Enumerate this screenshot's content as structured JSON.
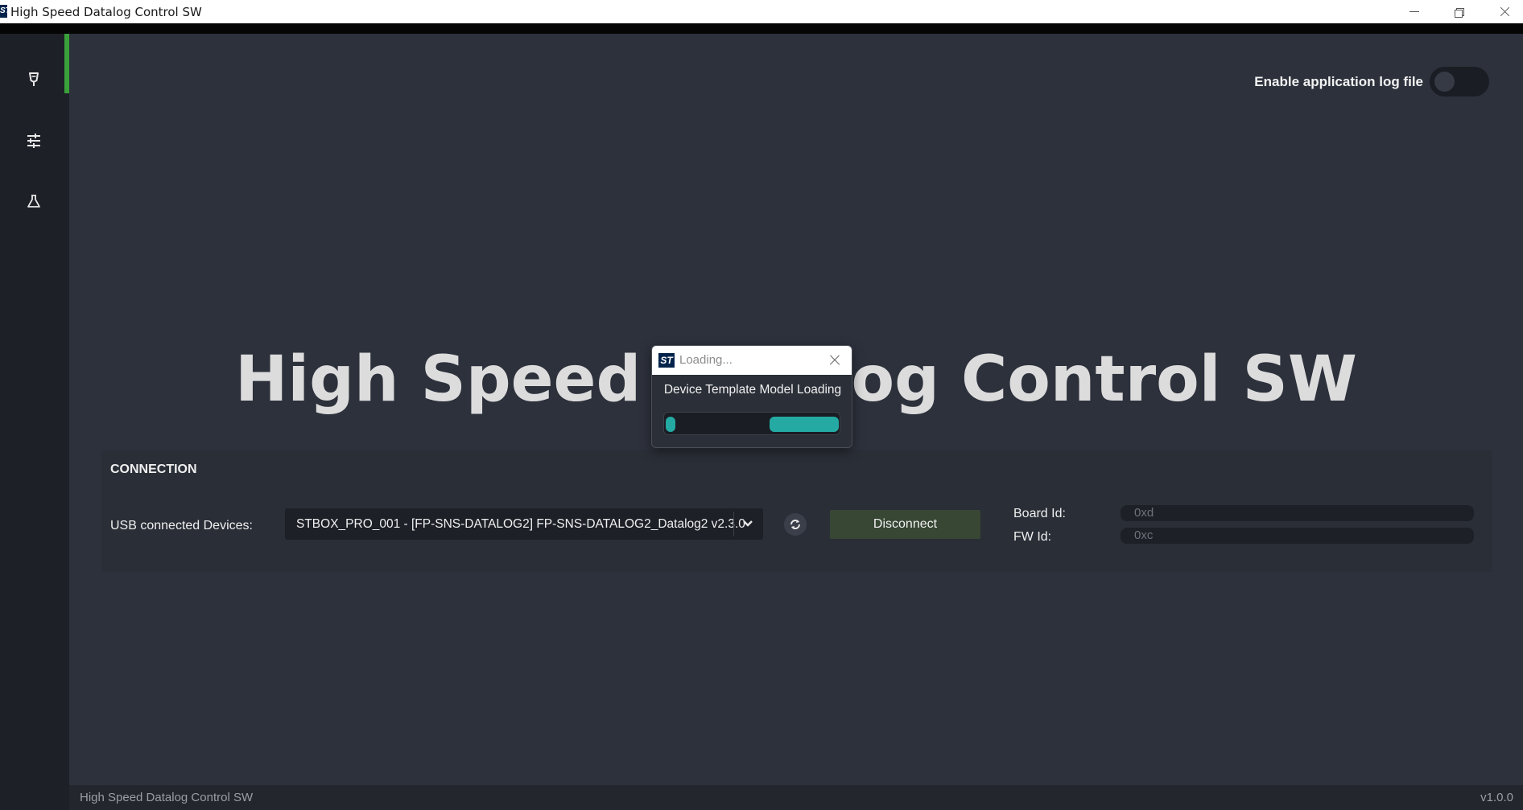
{
  "window": {
    "title": "High Speed Datalog Control SW",
    "logo_text": "ST"
  },
  "sidebar": {
    "items": [
      {
        "icon": "device-plug-icon",
        "active": true
      },
      {
        "icon": "sliders-icon",
        "active": false
      },
      {
        "icon": "flask-icon",
        "active": false
      }
    ],
    "accent": "#3aa13a"
  },
  "header": {
    "log_toggle_label": "Enable application log file",
    "log_toggle_on": false
  },
  "main": {
    "big_title": "High Speed Datalog Control SW"
  },
  "connection": {
    "title": "CONNECTION",
    "usb_label": "USB connected Devices:",
    "selected_device": "STBOX_PRO_001 - [FP-SNS-DATALOG2] FP-SNS-DATALOG2_Datalog2 v2.3.0",
    "disconnect_label": "Disconnect",
    "board_id_label": "Board Id:",
    "board_id_value": "0xd",
    "fw_id_label": "FW Id:",
    "fw_id_value": "0xc"
  },
  "dialog": {
    "title": "Loading...",
    "logo_text": "ST",
    "message": "Device Template Model Loading",
    "progress_color": "#24aaa2"
  },
  "statusbar": {
    "left": "High Speed Datalog Control SW",
    "version": "v1.0.0"
  }
}
